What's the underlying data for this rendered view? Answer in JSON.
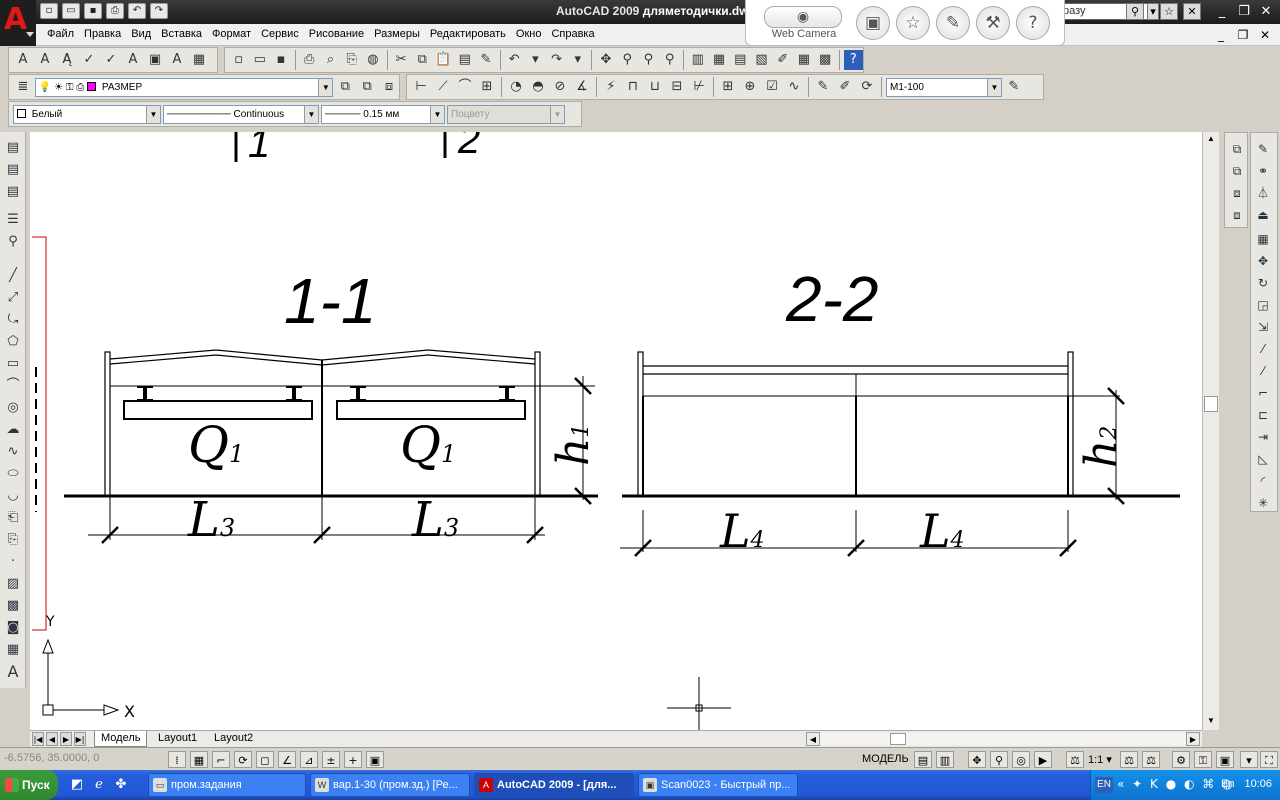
{
  "titlebar": {
    "title": "AutoCAD 2009",
    "filename": "дляметодички.dwg",
    "search_text": "разу",
    "qat_icons": [
      "new-icon",
      "open-icon",
      "save-icon",
      "print-icon",
      "undo-icon",
      "redo-icon"
    ]
  },
  "webcam": {
    "label": "Web Camera"
  },
  "menu": [
    "Файл",
    "Правка",
    "Вид",
    "Вставка",
    "Формат",
    "Сервис",
    "Рисование",
    "Размеры",
    "Редактировать",
    "Окно",
    "Справка"
  ],
  "layers": {
    "current_layer": "РАЗМЕР",
    "dim_style": "М1-100"
  },
  "properties": {
    "color": "Белый",
    "linetype": "Continuous",
    "lineweight": "0.15 мм",
    "plotstyle": "Поцвету"
  },
  "drawing": {
    "top_marks": [
      "1",
      "2"
    ],
    "section_1": {
      "title": "1-1",
      "load_label": "Q",
      "load_sub": "1",
      "span_label": "L",
      "span_sub": "3",
      "height_label": "h",
      "height_sub": "1"
    },
    "section_2": {
      "title": "2-2",
      "span_label": "L",
      "span_sub": "4",
      "height_label": "h",
      "height_sub": "2"
    },
    "ucs_x": "X",
    "ucs_y": "Y"
  },
  "tabs": [
    "Модель",
    "Layout1",
    "Layout2"
  ],
  "status": {
    "model": "МОДЕЛЬ",
    "scale": "1:1",
    "coords": "-6.5756, 35.0000, 0"
  },
  "taskbar": {
    "start": "Пуск",
    "tasks": [
      "пром.задания",
      "вар.1-30 (пром.зд.) [Ре...",
      "AutoCAD 2009 - [для...",
      "Scan0023 - Быстрый пр..."
    ],
    "lang": "EN",
    "tray_lang": "En",
    "clock": "10:06"
  },
  "colors": {
    "titlebar": "#1c1c1c",
    "taskbar": "#245edb",
    "logo": "#e01818"
  }
}
